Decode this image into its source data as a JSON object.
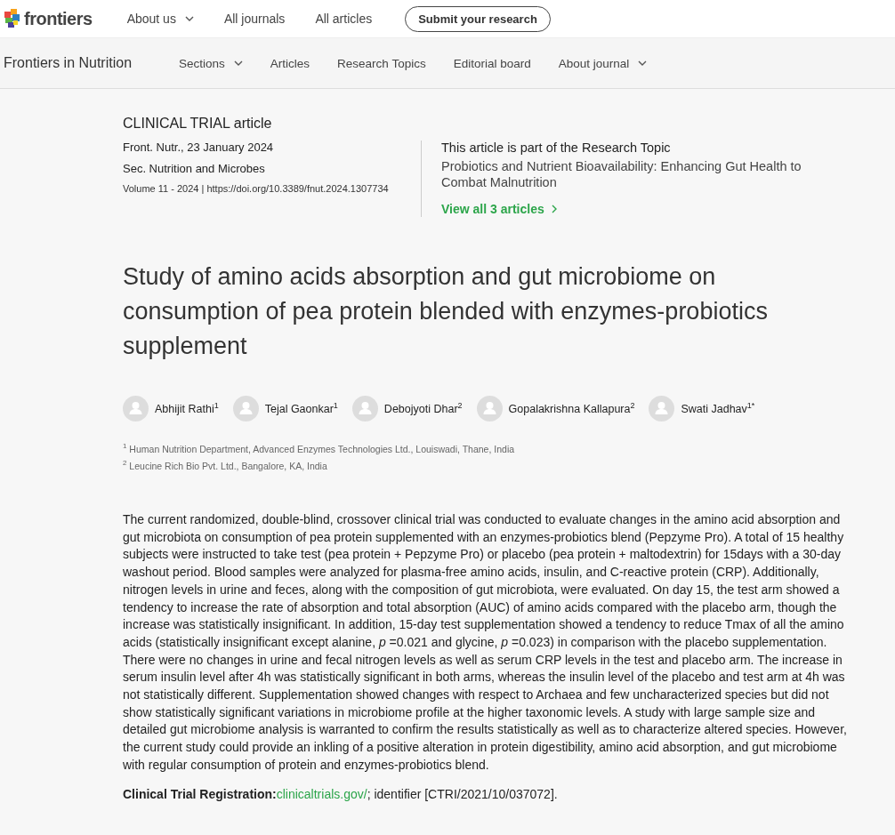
{
  "top_nav": {
    "logo": "frontiers",
    "items": [
      {
        "label": "About us",
        "dropdown": true
      },
      {
        "label": "All journals",
        "dropdown": false
      },
      {
        "label": "All articles",
        "dropdown": false
      }
    ],
    "action_button": "Submit your research"
  },
  "journal_nav": {
    "title": "Frontiers in Nutrition",
    "items": [
      {
        "label": "Sections",
        "dropdown": true
      },
      {
        "label": "Articles",
        "dropdown": false
      },
      {
        "label": "Research Topics",
        "dropdown": false
      },
      {
        "label": "Editorial board",
        "dropdown": false
      },
      {
        "label": "About journal",
        "dropdown": true
      }
    ]
  },
  "article": {
    "type": "CLINICAL TRIAL article",
    "journal_date": "Front. Nutr., 23 January 2024",
    "section": "Sec. Nutrition and Microbes",
    "volume": "Volume 11 - 2024",
    "doi_separator": "|",
    "doi": "https://doi.org/10.3389/fnut.2024.1307734",
    "research_topic": {
      "heading": "This article is part of the Research Topic",
      "title": "Probiotics and Nutrient Bioavailability: Enhancing Gut Health to Combat Malnutrition",
      "link": "View all 3 articles"
    },
    "title": "Study of amino acids absorption and gut microbiome on consumption of pea protein blended with enzymes-probiotics supplement",
    "authors": [
      "Abhijit Rathi$^{1}$",
      "Tejal Gaonkar$^{1}$",
      "Debojyoti Dhar$^{2}$",
      "Gopalakrishna Kallapura$^{2}$",
      "Swati Jadhav$^{1*}$"
    ],
    "affiliations": [
      "$^{1}$ Human Nutrition Department, Advanced Enzymes Technologies Ltd., Louiswadi, Thane, India",
      "$^{2}$ Leucine Rich Bio Pvt. Ltd., Bangalore, KA, India"
    ],
    "abstract": "The current randomized, double-blind, crossover clinical trial was conducted to evaluate changes in the amino acid absorption and gut microbiota on consumption of pea protein supplemented with an enzymes-probiotics blend (Pepzyme Pro). A total of 15 healthy subjects were instructed to take test (pea protein + Pepzyme Pro) or placebo (pea protein + maltodextrin) for 15days with a 30-day washout period. Blood samples were analyzed for plasma-free amino acids, insulin, and C-reactive protein (CRP). Additionally, nitrogen levels in urine and feces, along with the composition of gut microbiota, were evaluated. On day 15, the test arm showed a tendency to increase the rate of absorption and total absorption (AUC) of amino acids compared with the placebo arm, though the increase was statistically insignificant. In addition, 15-day test supplementation showed a tendency to reduce Tmax of all the amino acids (statistically insignificant except alanine, *p* =0.021 and glycine, *p* =0.023) in comparison with the placebo supplementation. There were no changes in urine and fecal nitrogen levels as well as serum CRP levels in the test and placebo arm. The increase in serum insulin level after 4h was statistically significant in both arms, whereas the insulin level of the placebo and test arm at 4h was not statistically different. Supplementation showed changes with respect to Archaea and few uncharacterized species but did not show statistically significant variations in microbiome profile at the higher taxonomic levels. A study with large sample size and detailed gut microbiome analysis is warranted to confirm the results statistically as well as to characterize altered species. However, the current study could provide an inkling of a positive alteration in protein digestibility, amino acid absorption, and gut microbiome with regular consumption of protein and enzymes-probiotics blend.",
    "registration": {
      "label": "Clinical Trial Registration:",
      "link": "clinicaltrials.gov/",
      "rest": "; identifier [CTRI/2021/10/037072]."
    }
  }
}
